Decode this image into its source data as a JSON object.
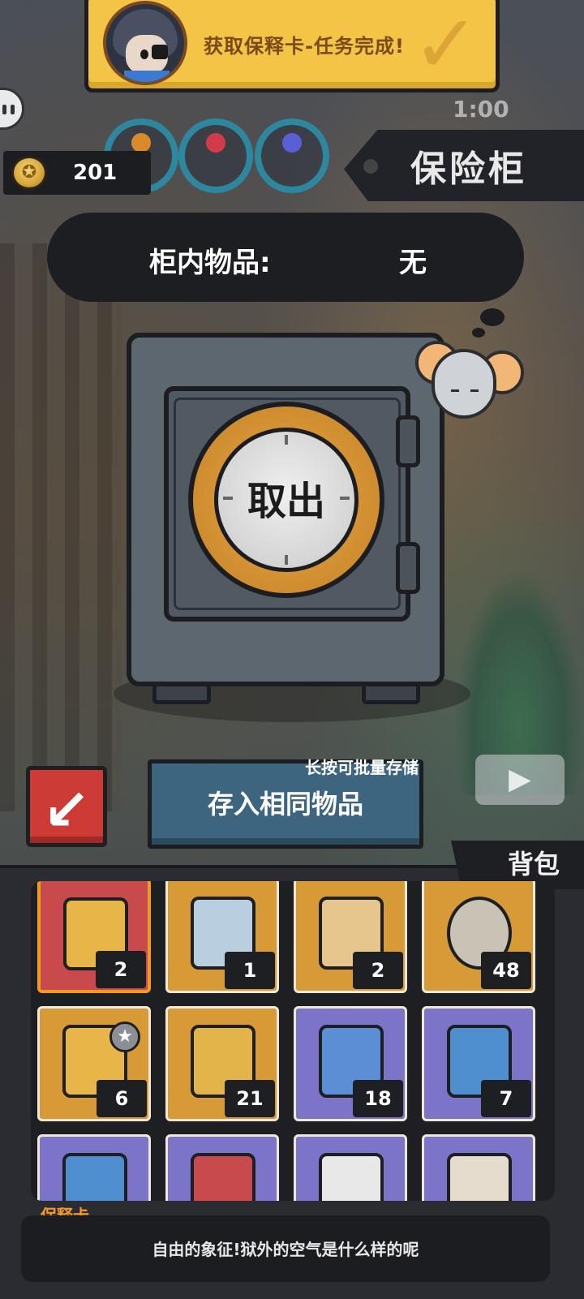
{
  "notification": {
    "title": "获取保释卡-任务完成!",
    "check_icon": "check-icon"
  },
  "status": {
    "timer": "1:00"
  },
  "currency": {
    "value": "201",
    "icon": "coin-icon"
  },
  "header": {
    "title": "保险柜"
  },
  "cabinet": {
    "label": "柜内物品:",
    "value": "无"
  },
  "safe": {
    "dial_label": "取出"
  },
  "actions": {
    "sort_icon": "sort-icon",
    "store_hint": "长按可批量存储",
    "store_label": "存入相同物品"
  },
  "backpack": {
    "tab_label": "背包",
    "items": [
      {
        "name": "bail-card",
        "count": "2",
        "color": "red",
        "selected": true
      },
      {
        "name": "capybara-pack",
        "count": "1",
        "color": "orange"
      },
      {
        "name": "paw-map",
        "count": "2",
        "color": "orange"
      },
      {
        "name": "film-reel",
        "count": "48",
        "color": "orange"
      },
      {
        "name": "bail-card-star",
        "count": "6",
        "color": "orange"
      },
      {
        "name": "ribbon-card",
        "count": "21",
        "color": "orange"
      },
      {
        "name": "toy-ticket",
        "count": "18",
        "color": "purple"
      },
      {
        "name": "blue-ticket",
        "count": "7",
        "color": "purple"
      },
      {
        "name": "item-9",
        "count": "",
        "color": "purple"
      },
      {
        "name": "item-10",
        "count": "",
        "color": "purple"
      },
      {
        "name": "item-11",
        "count": "",
        "color": "purple"
      },
      {
        "name": "item-12",
        "count": "",
        "color": "purple"
      }
    ]
  },
  "selected_item": {
    "name": "保释卡",
    "description": "自由的象征!狱外的空气是什么样的呢"
  },
  "colors": {
    "accent": "#f39a2a",
    "notify_bg": "#f3c445",
    "store_button": "#3e6580",
    "sort_button": "#cc3b36"
  }
}
